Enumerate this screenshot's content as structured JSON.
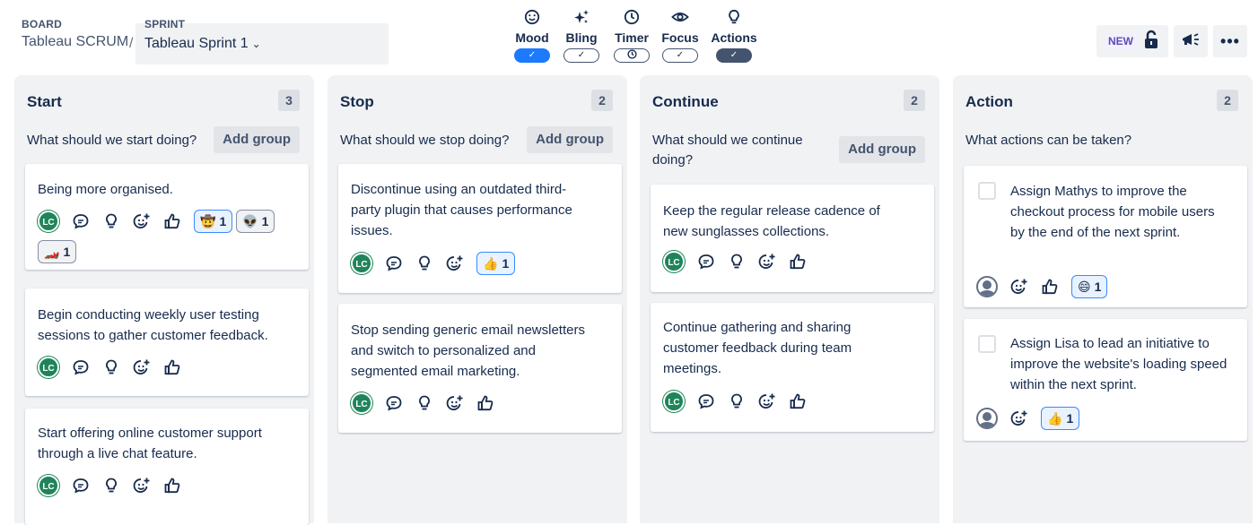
{
  "header": {
    "board_label": "BOARD",
    "board_name": "Tableau SCRUM",
    "separator": "/",
    "sprint_label": "SPRINT",
    "sprint_name": "Tableau Sprint 1",
    "toolbar": [
      {
        "label": "Mood",
        "icon": "smiley-icon",
        "state": "on-blue"
      },
      {
        "label": "Bling",
        "icon": "sparkle-icon",
        "state": "off"
      },
      {
        "label": "Timer",
        "icon": "clock-icon",
        "state": "timer"
      },
      {
        "label": "Focus",
        "icon": "eye-icon",
        "state": "off"
      },
      {
        "label": "Actions",
        "icon": "lightbulb-icon",
        "state": "on-dark"
      }
    ],
    "new_badge": "NEW"
  },
  "columns": [
    {
      "title": "Start",
      "count": "3",
      "prompt": "What should we start doing?",
      "add_label": "Add group",
      "cards": [
        {
          "text": "Being more organised.",
          "avatar": "LC",
          "reactions": [
            {
              "emoji": "🤠",
              "count": "1",
              "active": true
            },
            {
              "emoji": "👽",
              "count": "1",
              "active": false
            },
            {
              "emoji": "🏎️",
              "count": "1",
              "active": false
            }
          ]
        },
        {
          "text": "Begin conducting weekly user testing sessions to gather customer feedback.",
          "avatar": "LC",
          "reactions": []
        },
        {
          "text": "Start offering online customer support through a live chat feature.",
          "avatar": "LC",
          "reactions": []
        }
      ]
    },
    {
      "title": "Stop",
      "count": "2",
      "prompt": "What should we stop doing?",
      "add_label": "Add group",
      "cards": [
        {
          "text": "Discontinue using an outdated third-party plugin that causes performance issues.",
          "avatar": "LC",
          "reactions": [
            {
              "emoji": "👍",
              "count": "1",
              "active": true
            }
          ]
        },
        {
          "text": "Stop sending generic email newsletters and switch to personalized and segmented email marketing.",
          "avatar": "LC",
          "reactions": []
        }
      ]
    },
    {
      "title": "Continue",
      "count": "2",
      "prompt": "What should we continue doing?",
      "add_label": "Add group",
      "cards": [
        {
          "text": "Keep the regular release cadence of new sunglasses collections.",
          "avatar": "LC",
          "reactions": []
        },
        {
          "text": "Continue gathering and sharing customer feedback during team meetings.",
          "avatar": "LC",
          "reactions": []
        }
      ]
    },
    {
      "title": "Action",
      "count": "2",
      "prompt": "What actions can be taken?",
      "cards": [
        {
          "text": "Assign Mathys to improve the checkout process for mobile users by the end of the next sprint.",
          "reactions": [
            {
              "emoji": "😄",
              "count": "1",
              "active": true
            }
          ]
        },
        {
          "text": "Assign Lisa to lead an initiative to improve the website's loading speed within the next sprint.",
          "reactions": [
            {
              "emoji": "👍",
              "count": "1",
              "active": true
            }
          ]
        }
      ]
    }
  ]
}
